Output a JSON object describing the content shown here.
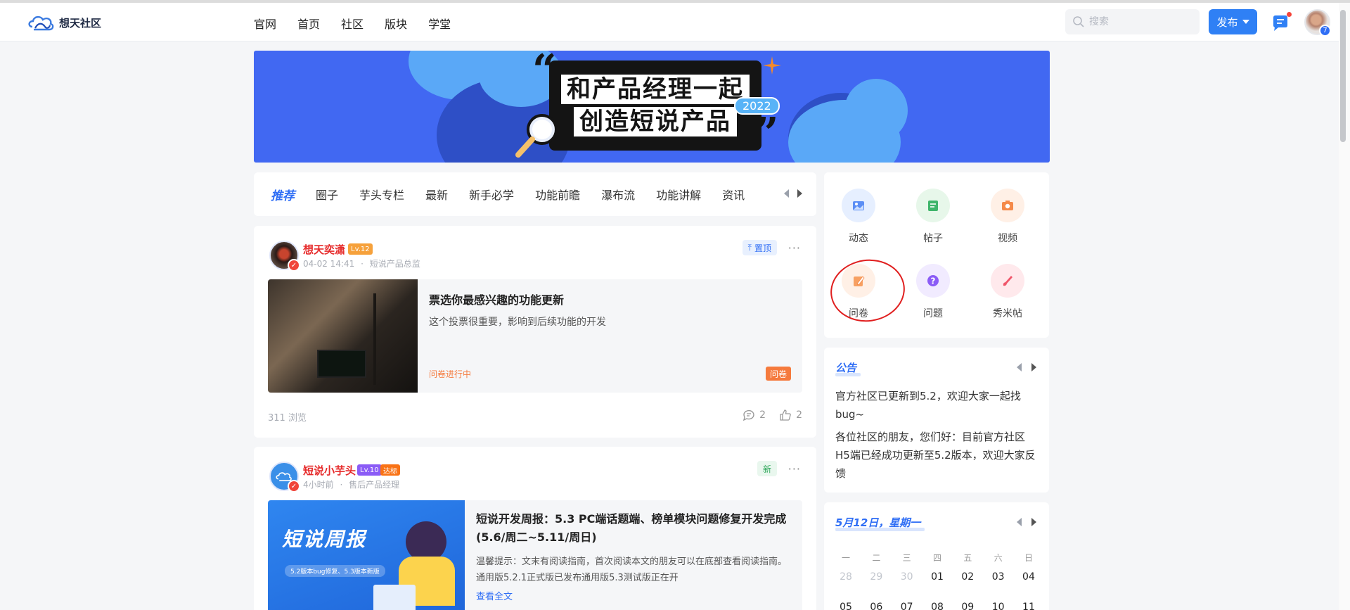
{
  "header": {
    "logo_text": "想天社区",
    "nav": [
      "官网",
      "首页",
      "社区",
      "版块",
      "学堂"
    ],
    "search_placeholder": "搜索",
    "publish_label": "发布",
    "notification_count": "7"
  },
  "banner": {
    "line1": "和产品经理一起",
    "line2": "创造短说产品",
    "year": "2022",
    "open_quote": "“",
    "close_quote": "”"
  },
  "tabs": [
    "推荐",
    "圈子",
    "芋头专栏",
    "最新",
    "新手必学",
    "功能前瞻",
    "瀑布流",
    "功能讲解",
    "资讯"
  ],
  "posts": [
    {
      "author": "想天奕潇",
      "level": "Lv.12",
      "time": "04-02 14:41",
      "role": "短说产品总监",
      "pin_label": "置顶",
      "title": "票选你最感兴趣的功能更新",
      "desc": "这个投票很重要，影响到后续功能的开发",
      "status": "问卷进行中",
      "type_tag": "问卷",
      "views": "311 浏览",
      "comments": "2",
      "likes": "2"
    },
    {
      "author": "短说小芋头",
      "level": "Lv.10",
      "extra_badge": "达标",
      "time": "4小时前",
      "role": "售后产品经理",
      "pin_label": "新",
      "title": "短说开发周报：5.3 PC端话题端、榜单模块问题修复开发完成(5.6/周二~5.11/周日)",
      "desc": "温馨提示：文末有阅读指南，首次阅读本文的朋友可以在底部查看阅读指南。通用版5.2.1正式版已发布通用版5.3测试版正在开",
      "read_more": "查看全文",
      "cover_title": "短说周报",
      "cover_sub": "5.2版本bug修复、5.3版本新版"
    }
  ],
  "quick_actions": [
    "动态",
    "帖子",
    "视频",
    "问卷",
    "问题",
    "秀米帖"
  ],
  "notice": {
    "title": "公告",
    "items": [
      "官方社区已更新到5.2，欢迎大家一起找bug~",
      "各位社区的朋友，您们好：目前官方社区H5端已经成功更新至5.2版本，欢迎大家反馈"
    ]
  },
  "calendar": {
    "title": "5月12日，星期一",
    "weekdays": [
      "一",
      "二",
      "三",
      "四",
      "五",
      "六",
      "日"
    ],
    "row1": [
      "28",
      "29",
      "30",
      "01",
      "02",
      "03",
      "04"
    ],
    "row2": [
      "05",
      "06",
      "07",
      "08",
      "09",
      "10",
      "11"
    ]
  },
  "colors": {
    "accent": "#2f6ef5",
    "publish": "#2f80f5",
    "author_red": "#e62a2a",
    "banner_bg": "#4168f2",
    "status_orange": "#f57a3d"
  }
}
